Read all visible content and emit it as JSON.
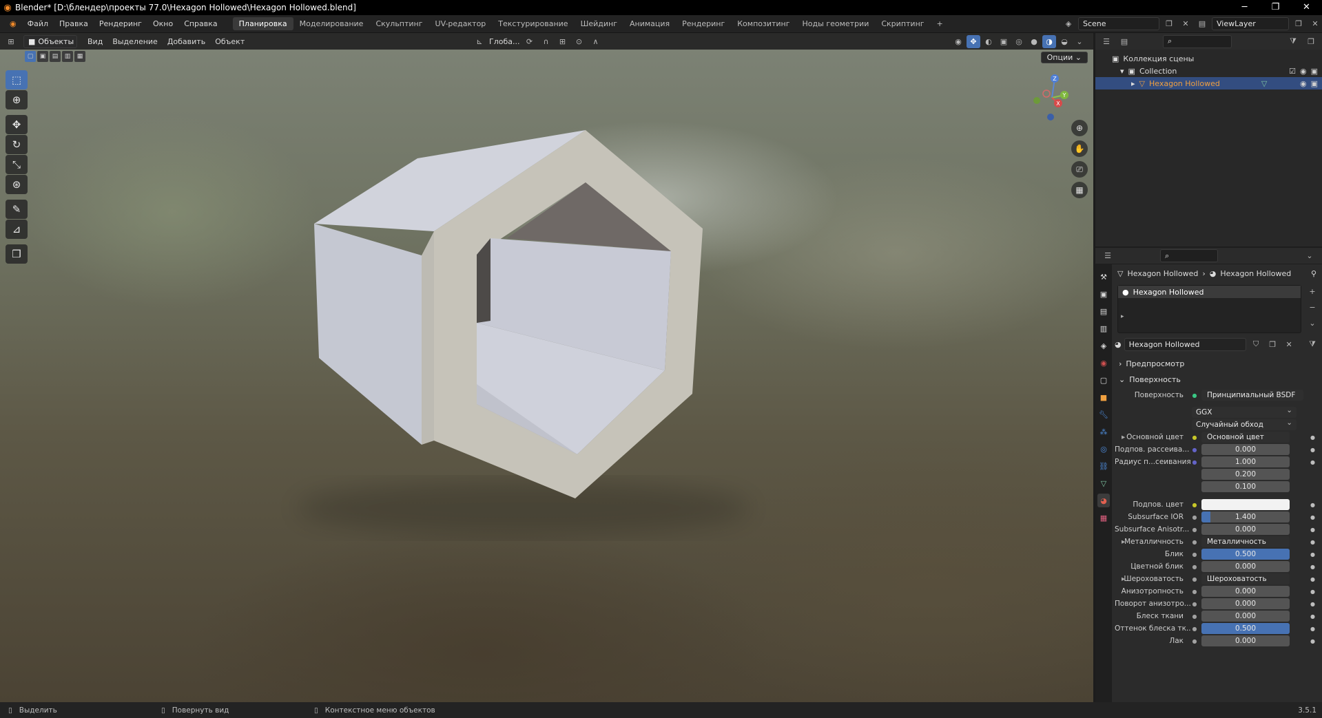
{
  "titlebar": {
    "title": "Blender* [D:\\блендер\\проекты 77.0\\Hexagon Hollowed\\Hexagon Hollowed.blend]",
    "minimize": "─",
    "maximize": "❐",
    "close": "✕"
  },
  "menu": [
    "Файл",
    "Правка",
    "Рендеринг",
    "Окно",
    "Справка"
  ],
  "workspaces": [
    {
      "label": "Планировка",
      "active": true
    },
    {
      "label": "Моделирование",
      "active": false
    },
    {
      "label": "Скульптинг",
      "active": false
    },
    {
      "label": "UV-редактор",
      "active": false
    },
    {
      "label": "Текстурирование",
      "active": false
    },
    {
      "label": "Шейдинг",
      "active": false
    },
    {
      "label": "Анимация",
      "active": false
    },
    {
      "label": "Рендеринг",
      "active": false
    },
    {
      "label": "Композитинг",
      "active": false
    },
    {
      "label": "Ноды геометрии",
      "active": false
    },
    {
      "label": "Скриптинг",
      "active": false
    }
  ],
  "add_workspace": "+",
  "scene": {
    "name": "Scene",
    "view_layer": "ViewLayer"
  },
  "viewport": {
    "mode": "Объекты",
    "menus": [
      "Вид",
      "Выделение",
      "Добавить",
      "Объект"
    ],
    "orientation": "Глоба...",
    "options": "Опции"
  },
  "outliner": {
    "root": "Коллекция сцены",
    "collection": "Collection",
    "object": "Hexagon Hollowed"
  },
  "properties": {
    "breadcrumb_object": "Hexagon Hollowed",
    "breadcrumb_material": "Hexagon Hollowed",
    "material_slot": "Hexagon Hollowed",
    "material_name": "Hexagon Hollowed",
    "preview_label": "Предпросмотр",
    "surface_panel": "Поверхность",
    "surface_label": "Поверхность",
    "surface_value": "Принципиальный BSDF",
    "distribution": "GGX",
    "subsurface_method": "Случайный обход",
    "rows": [
      {
        "label": "Основной цвет",
        "kind": "link",
        "value": "Основной цвет",
        "expand": true,
        "sock": "#c7c729"
      },
      {
        "label": "Подпов. рассеива...",
        "kind": "value",
        "value": "0.000",
        "fill": 0,
        "sock": "#6363c7"
      },
      {
        "label": "Радиус п...сеивания",
        "kind": "value",
        "value": "1.000",
        "fill": 0,
        "sock": "#6363c7"
      },
      {
        "label": "",
        "kind": "value",
        "value": "0.200",
        "fill": 0,
        "sock": ""
      },
      {
        "label": "",
        "kind": "value",
        "value": "0.100",
        "fill": 0,
        "sock": ""
      },
      {
        "label": "Подпов. цвет",
        "kind": "color",
        "value": "",
        "fill": 0,
        "sock": "#c7c729"
      },
      {
        "label": "Subsurface IOR",
        "kind": "value",
        "value": "1.400",
        "fill": 0.1,
        "sock": "#a1a1a1"
      },
      {
        "label": "Subsurface Anisotr...",
        "kind": "value",
        "value": "0.000",
        "fill": 0,
        "sock": "#a1a1a1"
      },
      {
        "label": "Металличность",
        "kind": "link",
        "value": "Металличность",
        "expand": true,
        "sock": "#a1a1a1"
      },
      {
        "label": "Блик",
        "kind": "value",
        "value": "0.500",
        "fill": 1,
        "sock": "#a1a1a1"
      },
      {
        "label": "Цветной блик",
        "kind": "value",
        "value": "0.000",
        "fill": 0,
        "sock": "#a1a1a1"
      },
      {
        "label": "Шероховатость",
        "kind": "link",
        "value": "Шероховатость",
        "expand": true,
        "sock": "#a1a1a1"
      },
      {
        "label": "Анизотропность",
        "kind": "value",
        "value": "0.000",
        "fill": 0,
        "sock": "#a1a1a1"
      },
      {
        "label": "Поворот анизотро...",
        "kind": "value",
        "value": "0.000",
        "fill": 0,
        "sock": "#a1a1a1"
      },
      {
        "label": "Блеск ткани",
        "kind": "value",
        "value": "0.000",
        "fill": 0,
        "sock": "#a1a1a1"
      },
      {
        "label": "Оттенок блеска тк...",
        "kind": "value",
        "value": "0.500",
        "fill": 1,
        "sock": "#a1a1a1"
      },
      {
        "label": "Лак",
        "kind": "value",
        "value": "0.000",
        "fill": 0,
        "sock": "#a1a1a1"
      }
    ]
  },
  "status": {
    "select": "Выделить",
    "rotate": "Повернуть вид",
    "context": "Контекстное меню объектов",
    "version": "3.5.1"
  },
  "colors": {
    "accent": "#4772b3",
    "selected_row": "#334d80",
    "object_orange": "#f0a040"
  }
}
